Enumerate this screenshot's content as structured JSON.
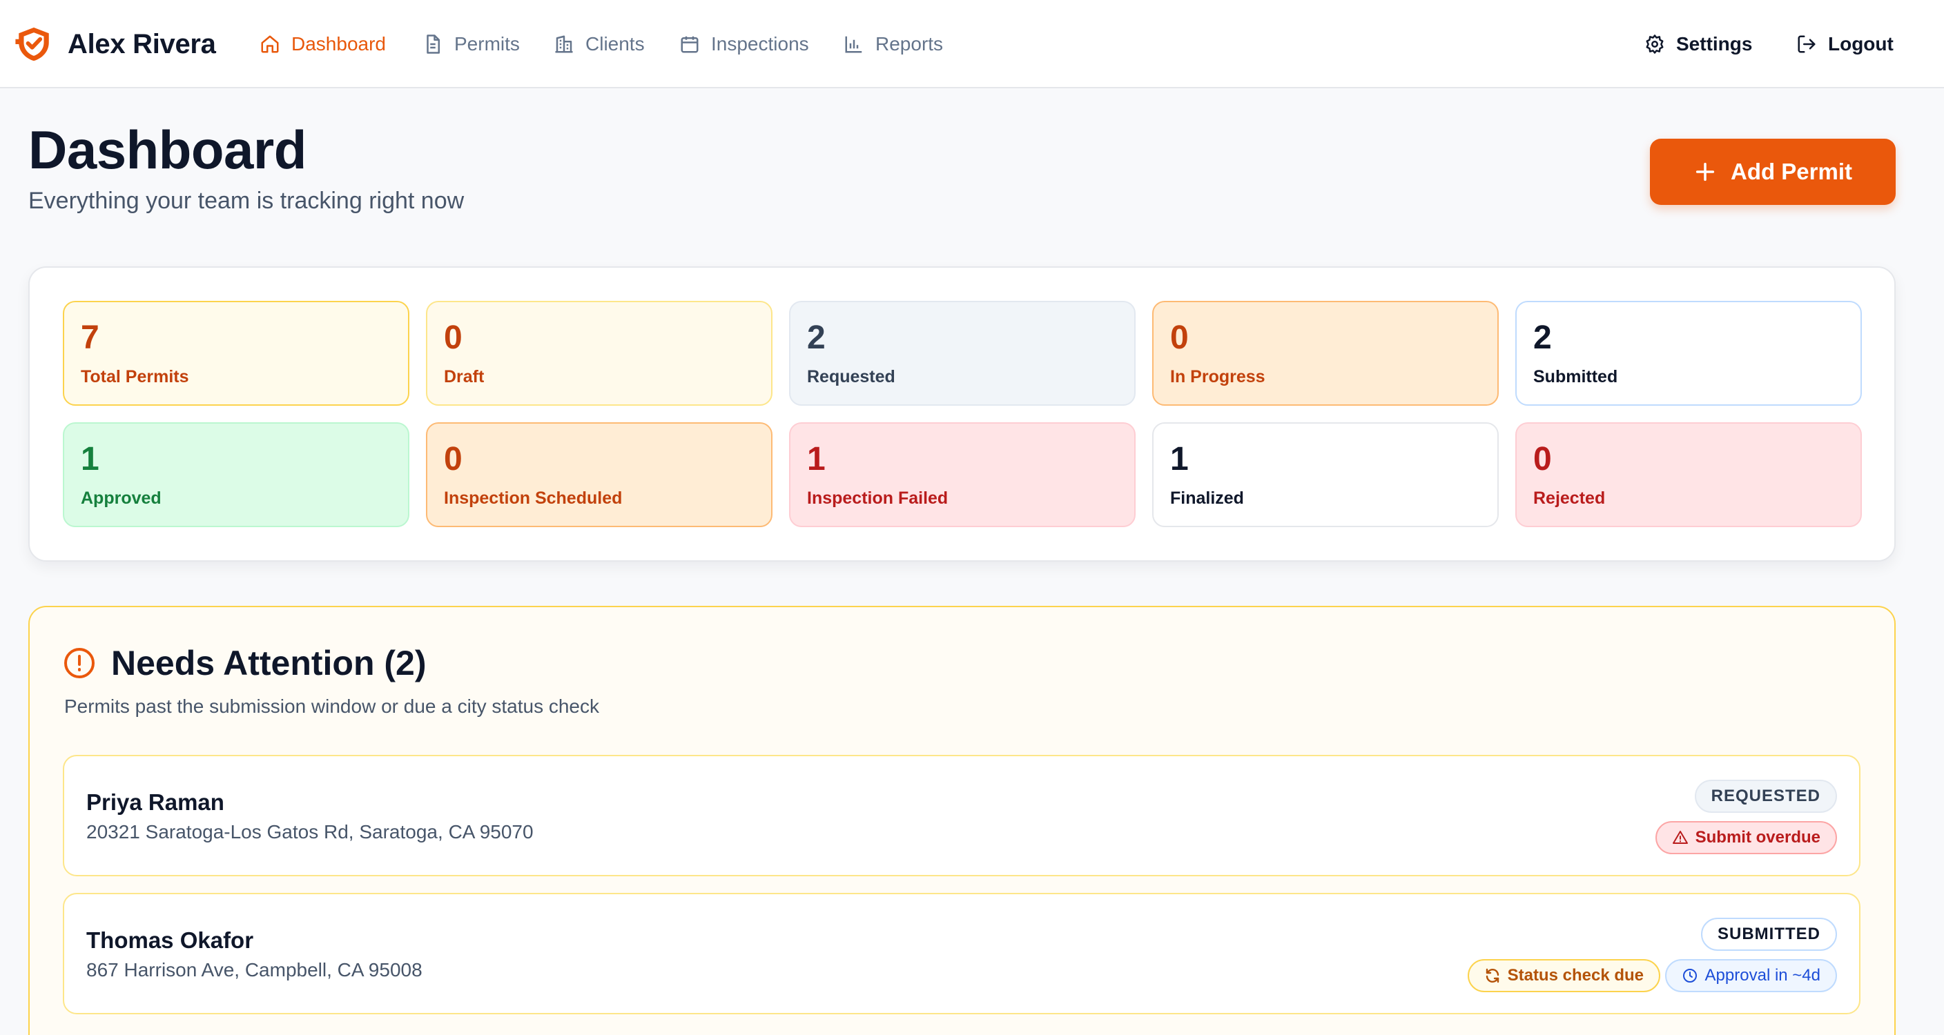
{
  "nav": {
    "brand": "Alex Rivera",
    "links": [
      {
        "label": "Dashboard",
        "icon": "home-icon",
        "active": true
      },
      {
        "label": "Permits",
        "icon": "document-icon"
      },
      {
        "label": "Clients",
        "icon": "building-icon"
      },
      {
        "label": "Inspections",
        "icon": "calendar-icon"
      },
      {
        "label": "Reports",
        "icon": "bar-chart-icon"
      }
    ],
    "settings_label": "Settings",
    "logout_label": "Logout"
  },
  "header": {
    "title": "Dashboard",
    "subtitle": "Everything your team is tracking right now",
    "add_button": "Add Permit"
  },
  "stats": [
    {
      "value": "7",
      "label": "Total Permits"
    },
    {
      "value": "0",
      "label": "Draft"
    },
    {
      "value": "2",
      "label": "Requested"
    },
    {
      "value": "0",
      "label": "In Progress"
    },
    {
      "value": "2",
      "label": "Submitted"
    },
    {
      "value": "1",
      "label": "Approved"
    },
    {
      "value": "0",
      "label": "Inspection Scheduled"
    },
    {
      "value": "1",
      "label": "Inspection Failed"
    },
    {
      "value": "1",
      "label": "Finalized"
    },
    {
      "value": "0",
      "label": "Rejected"
    }
  ],
  "attention": {
    "title": "Needs Attention (2)",
    "subtitle": "Permits past the submission window or due a city status check",
    "items": [
      {
        "name": "Priya Raman",
        "address": "20321 Saratoga-Los Gatos Rd, Saratoga, CA 95070",
        "status": "REQUESTED",
        "flags": [
          "Submit overdue"
        ]
      },
      {
        "name": "Thomas Okafor",
        "address": "867 Harrison Ave, Campbell, CA 95008",
        "status": "SUBMITTED",
        "flags": [
          "Status check due",
          "Approval in ~4d"
        ]
      }
    ]
  },
  "colors": {
    "accent": "#ea580c",
    "text": "#0f172a",
    "muted": "#475569"
  }
}
